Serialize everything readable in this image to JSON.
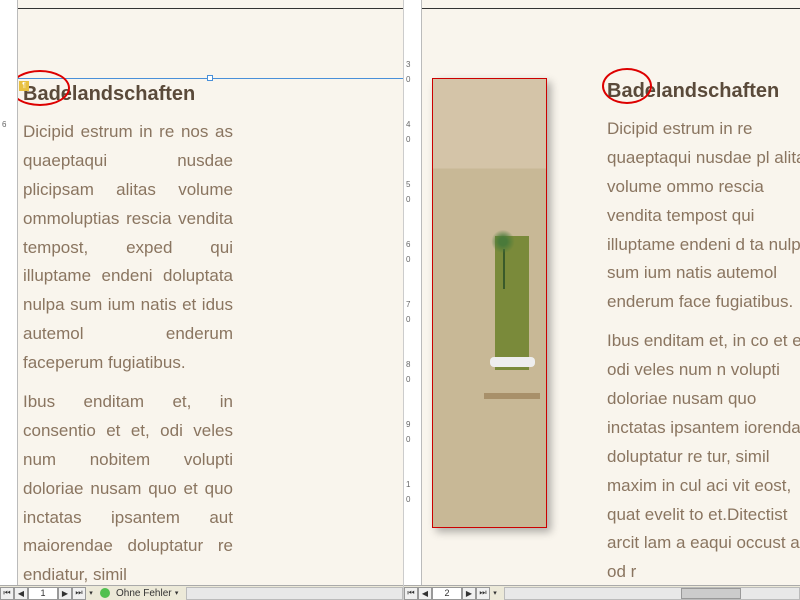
{
  "left_pane": {
    "heading": "Badelandschaften",
    "para1": "Dicipid estrum in re nos as quaeptaqui nusdae plicipsam alitas volume ommoluptias rescia vendita tempost, exped qui illuptame endeni doluptata nulpa sum ium natis et idus autemol enderum faceperum fugiatibus.",
    "para2": "Ibus enditam et, in consentio et et, odi veles num nobitem volupti doloriae nusam quo et quo inctatas ipsantem aut maiorendae doluptatur re endiatur, simil",
    "ruler_ticks": [
      "6"
    ],
    "status": {
      "page": "1",
      "nav_first": "⏮",
      "nav_prev": "◀",
      "nav_next": "▶",
      "nav_last": "⏭",
      "error_icon_color": "#50c050",
      "error_text": "Ohne Fehler"
    }
  },
  "right_pane": {
    "heading": "Badelandschaften",
    "para1": "Dicipid estrum in re quaeptaqui nusdae pl alitas volume ommo rescia vendita tempost qui illuptame endeni d ta nulpa sum ium natis autemol enderum face fugiatibus.",
    "para2": "Ibus enditam et, in co et et, odi veles num n volupti doloriae nusam quo inctatas ipsantem iorendae doluptatur re tur, simil maxim in cul aci vit eost, quat evelit to et.Ditectist arcit lam a eaqui occust aut od r",
    "ruler_ticks": [
      "3",
      "0",
      "4",
      "0",
      "5",
      "0",
      "6",
      "0",
      "7",
      "0",
      "8",
      "0",
      "9",
      "0",
      "1",
      "0"
    ],
    "status": {
      "page": "2",
      "nav_first": "⏮",
      "nav_prev": "◀",
      "nav_next": "▶",
      "nav_last": "⏭"
    }
  }
}
